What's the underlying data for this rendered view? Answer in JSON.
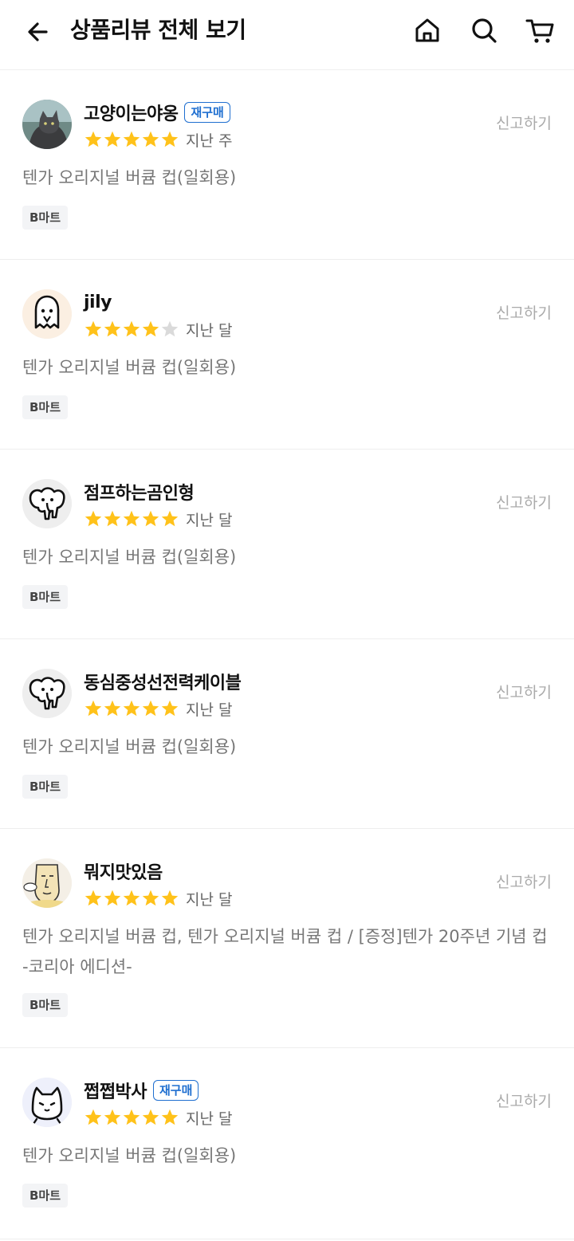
{
  "header": {
    "title": "상품리뷰 전체 보기",
    "icons": [
      "back-arrow-icon",
      "home-icon",
      "search-icon",
      "cart-icon"
    ]
  },
  "colors": {
    "star_filled": "#FFC21A",
    "star_empty": "#DADADA",
    "badge": "#1F6FD0"
  },
  "reviews": [
    {
      "nickname": "고양이는야옹",
      "badge": "재구매",
      "rating": 5,
      "time": "지난 주",
      "report": "신고하기",
      "product": "텐가 오리지널 버큠 컵(일회용)",
      "store": "B마트",
      "avatar": "cat-photo"
    },
    {
      "nickname": "jily",
      "badge": "",
      "rating": 4,
      "time": "지난 달",
      "report": "신고하기",
      "product": "텐가 오리지널 버큠 컵(일회용)",
      "store": "B마트",
      "avatar": "ghost"
    },
    {
      "nickname": "점프하는곰인형",
      "badge": "",
      "rating": 5,
      "time": "지난 달",
      "report": "신고하기",
      "product": "텐가 오리지널 버큠 컵(일회용)",
      "store": "B마트",
      "avatar": "elephant"
    },
    {
      "nickname": "동심중성선전력케이블",
      "badge": "",
      "rating": 5,
      "time": "지난 달",
      "report": "신고하기",
      "product": "텐가 오리지널 버큠 컵(일회용)",
      "store": "B마트",
      "avatar": "elephant"
    },
    {
      "nickname": "뭐지맛있음",
      "badge": "",
      "rating": 5,
      "time": "지난 달",
      "report": "신고하기",
      "product": "텐가 오리지널 버큠 컵, 텐가 오리지널 버큠 컵 / [증정]텐가 20주년 기념 컵 -코리아 에디션-",
      "store": "B마트",
      "avatar": "face-drawing"
    },
    {
      "nickname": "쩝쩝박사",
      "badge": "재구매",
      "rating": 5,
      "time": "지난 달",
      "report": "신고하기",
      "product": "텐가 오리지널 버큠 컵(일회용)",
      "store": "B마트",
      "avatar": "cat-face"
    }
  ]
}
